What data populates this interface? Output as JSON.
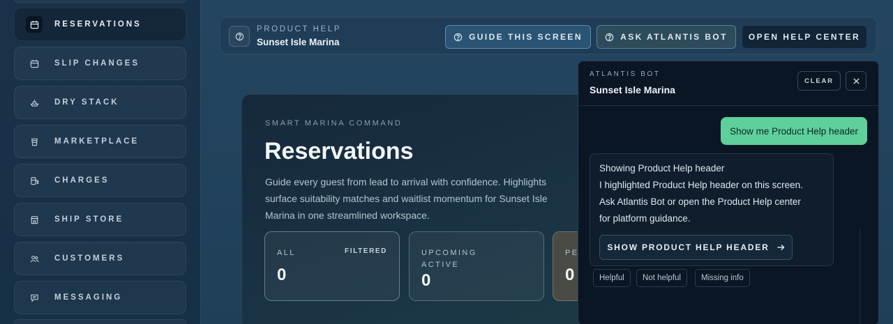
{
  "sidebar": {
    "items": [
      {
        "label": "RESERVATIONS",
        "icon": "calendar-icon",
        "active": true
      },
      {
        "label": "SLIP CHANGES",
        "icon": "calendar-icon",
        "active": false
      },
      {
        "label": "DRY STACK",
        "icon": "boat-icon",
        "active": false
      },
      {
        "label": "MARKETPLACE",
        "icon": "cup-icon",
        "active": false
      },
      {
        "label": "CHARGES",
        "icon": "fuel-icon",
        "active": false
      },
      {
        "label": "SHIP STORE",
        "icon": "store-icon",
        "active": false
      },
      {
        "label": "CUSTOMERS",
        "icon": "users-icon",
        "active": false
      },
      {
        "label": "MESSAGING",
        "icon": "message-icon",
        "active": false
      }
    ]
  },
  "help_bar": {
    "eyebrow": "PRODUCT HELP",
    "title": "Sunset Isle Marina",
    "guide_label": "GUIDE THIS SCREEN",
    "ask_label": "ASK ATLANTIS BOT",
    "open_label": "OPEN HELP CENTER"
  },
  "hero": {
    "eyebrow": "SMART MARINA COMMAND",
    "title": "Reservations",
    "description": "Guide every guest from lead to arrival with confidence. Highlights surface suitability matches and waitlist momentum for Sunset Isle Marina in one streamlined workspace.",
    "stats": [
      {
        "label": "ALL",
        "tag": "FILTERED",
        "value": "0"
      },
      {
        "label_line1": "UPCOMING",
        "label_line2": "ACTIVE",
        "value": "0"
      },
      {
        "label": "PE",
        "value": "0"
      }
    ]
  },
  "chat": {
    "eyebrow": "ATLANTIS BOT",
    "title": "Sunset Isle Marina",
    "clear_label": "CLEAR",
    "user_message": "Show me Product Help header",
    "bot_lines": [
      "Showing Product Help header",
      "I highlighted Product Help header on this screen.",
      "Ask Atlantis Bot or open the Product Help center",
      "for platform guidance."
    ],
    "bot_action_label": "SHOW PRODUCT HELP HEADER",
    "feedback": {
      "helpful": "Helpful",
      "not_helpful": "Not helpful",
      "missing": "Missing info"
    }
  },
  "colors": {
    "accent_green": "#5fcf9c",
    "panel_dark": "#0b1624",
    "main_bg": "#244560"
  }
}
